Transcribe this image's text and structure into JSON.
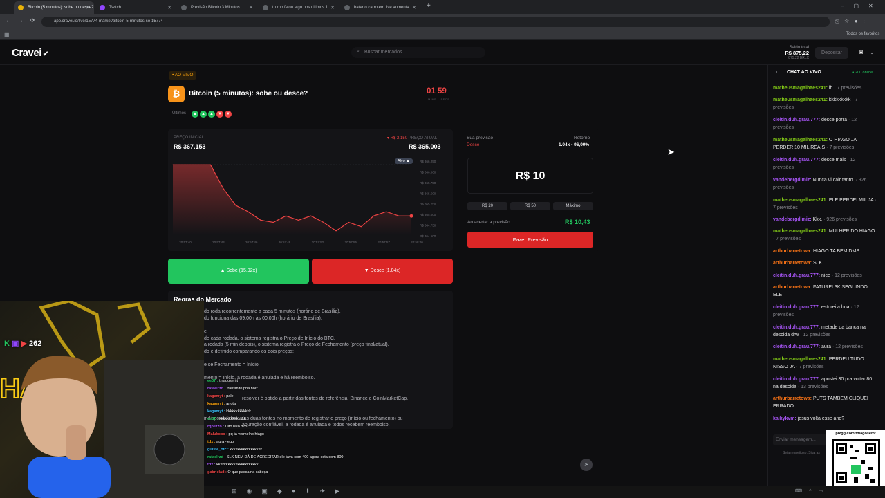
{
  "browser": {
    "tabs": [
      {
        "label": "Bitcoin (5 minutos): sobe ou desce?",
        "active": true,
        "color": "#eab308"
      },
      {
        "label": "Twitch",
        "active": false,
        "color": "#9146ff"
      },
      {
        "label": "Previsão Bitcoin 3 Minutos",
        "active": false,
        "color": "#9aa0a6"
      },
      {
        "label": "trump falou algo nos ultimos 1",
        "active": false,
        "color": "#9aa0a6"
      },
      {
        "label": "bater o carro em live aumenta",
        "active": false,
        "color": "#9aa0a6"
      }
    ],
    "new_tab": "+",
    "url": "app.cravei.io/live/15774-market/bitcoin-5-minutos-so-15774",
    "bookmarks_label": "Todos os favoritos"
  },
  "header": {
    "logo": "Cravei",
    "search_placeholder": "Buscar mercados...",
    "balance_label": "Saldo total",
    "balance_value": "R$ 875,22",
    "balance_sub": "875,22 BRLX",
    "deposit_label": "Depositar",
    "user_initial": "H"
  },
  "market": {
    "live_badge": "• AO VIVO",
    "title": "Bitcoin (5 minutos): sobe ou desce?",
    "timer_min": "01",
    "timer_sec": "59",
    "timer_min_label": "MINS",
    "timer_sec_label": "SECS",
    "ultimos_label": "Últimos",
    "history": [
      "up",
      "up",
      "up",
      "down",
      "down"
    ],
    "price_start_label": "PREÇO INICIAL",
    "price_start": "R$ 367.153",
    "price_delta": "▾ R$ 2.150",
    "price_now_label": "PREÇO ATUAL",
    "price_now": "R$ 365.003",
    "alvo_label": "Alvo ▲",
    "up_label": "Sobe (15.92x)",
    "down_label": "Desce (1.04x)",
    "rules_title": "Regras do Mercado"
  },
  "chart_data": {
    "type": "line",
    "x": [
      "20:57:40",
      "20:57:43",
      "20:57:46",
      "20:57:49",
      "20:57:52",
      "20:57:55",
      "20:57:57",
      "20:58:00"
    ],
    "values": [
      366.15,
      366.15,
      366.15,
      366.15,
      365.6,
      365.2,
      365.05,
      364.85,
      364.8,
      364.95,
      364.85,
      364.95,
      364.8,
      364.6,
      364.8,
      364.7,
      364.95,
      365.05,
      364.95,
      364.95
    ],
    "yticks": [
      "R$ 366.250",
      "R$ 366.000",
      "R$ 365.750",
      "R$ 365.500",
      "R$ 365.250",
      "R$ 365.000",
      "R$ 364.750",
      "R$ 364.500"
    ],
    "ylim": [
      364.5,
      366.25
    ],
    "line_color": "#ef4444"
  },
  "prediction": {
    "label": "Sua previsão",
    "side": "Desce",
    "return_label": "Retorno",
    "return_value": "1.04x • 96,00%",
    "amount": "R$ 10",
    "quick": [
      "R$ 20",
      "R$ 50",
      "Máximo"
    ],
    "hit_label": "Ao acertar a previsão",
    "hit_value": "R$ 10,43",
    "submit": "Fazer Previsão"
  },
  "rules": [
    "do roda recorrentemente a cada 5 minutos (horário de Brasília).",
    "do funciona das 09:00h às 00:00h (horário de Brasília).",
    "e",
    "de cada rodada, o sistema registra o Preço de Início do BTC.",
    "a rodada (5 min depois), o sistema registra o Preço de Fechamento (preço final/atual).",
    "do é definido comparando os dois preços:",
    "e se Fechamento = Início",
    "mento = Início, a rodada é anulada e há reembolso.",
    "resolver é obtido a partir das fontes de referência: Binance e CoinMarketCap.",
    "indisponibilidade das duas fontes no momento de registrar o preço (início ou fechamento) ou",
    "apuração confiável, a rodada é anulada e todos recebem reembolso."
  ],
  "chat": {
    "title": "CHAT AO VIVO",
    "online": "● 200 online",
    "messages": [
      {
        "user": "matheusmagalhaes241:",
        "text": " ih",
        "meta": " · 7 previsões",
        "c": "c1"
      },
      {
        "user": "matheusmagalhaes241:",
        "text": " kkkkkkkkk",
        "meta": " · 7 previsões",
        "c": "c1"
      },
      {
        "user": "cleitin.duh.grau.777:",
        "text": " desce porra",
        "meta": " · 12 previsões",
        "c": "c2"
      },
      {
        "user": "matheusmagalhaes241:",
        "text": " O HIAGO JA PERDER 10 MIL REAIS",
        "meta": " · 7 previsões",
        "c": "c1"
      },
      {
        "user": "cleitin.duh.grau.777:",
        "text": " desce mais",
        "meta": " · 12 previsões",
        "c": "c2"
      },
      {
        "user": "vandebergdimiz:",
        "text": " Nunca vi cair tanto.",
        "meta": " · 926 previsões",
        "c": "c2"
      },
      {
        "user": "matheusmagalhaes241:",
        "text": " ELE PERDEI MIL JA",
        "meta": " · 7 previsões",
        "c": "c1"
      },
      {
        "user": "vandebergdimiz:",
        "text": " Kkk.",
        "meta": " · 926 previsões",
        "c": "c2"
      },
      {
        "user": "matheusmagalhaes241:",
        "text": " MULHER DO HIAGO",
        "meta": " · 7 previsões",
        "c": "c1"
      },
      {
        "user": "arthurbarretowa:",
        "text": " HIAGO TA BEM DMS",
        "meta": "",
        "c": "c3"
      },
      {
        "user": "arthurbarretowa:",
        "text": " SLK",
        "meta": "",
        "c": "c3"
      },
      {
        "user": "cleitin.duh.grau.777:",
        "text": " nice",
        "meta": " · 12 previsões",
        "c": "c2"
      },
      {
        "user": "arthurbarretowa:",
        "text": " FATUREI 3K SEGUINDO ELE",
        "meta": "",
        "c": "c3"
      },
      {
        "user": "cleitin.duh.grau.777:",
        "text": " estorei a boa",
        "meta": " · 12 previsões",
        "c": "c2"
      },
      {
        "user": "cleitin.duh.grau.777:",
        "text": " metade da banca na descida drw",
        "meta": " · 12 previsões",
        "c": "c2"
      },
      {
        "user": "cleitin.duh.grau.777:",
        "text": " aura",
        "meta": " · 12 previsões",
        "c": "c2"
      },
      {
        "user": "matheusmagalhaes241:",
        "text": " PERDEU TUDO NISSO JA",
        "meta": " · 7 previsões",
        "c": "c1"
      },
      {
        "user": "cleitin.duh.grau.777:",
        "text": " apostei 30 pra voltar 80 na descida",
        "meta": " · 13 previsões",
        "c": "c2"
      },
      {
        "user": "arthurbarretowa:",
        "text": " PUTS TAMBEM CLIQUEI ERRADO",
        "meta": "",
        "c": "c3"
      },
      {
        "user": "kaikykvm:",
        "text": " jesus volta esse ano?",
        "meta": "",
        "c": "c2"
      }
    ],
    "input_placeholder": "Enviar mensagem...",
    "footer": "Seja respeitoso. Siga as",
    "qr_label": "pixgg.com/thiagosemt"
  },
  "stream": {
    "viewers": "262",
    "chat": [
      {
        "user": "ee07 :",
        "text": " thiagosemt"
      },
      {
        "user": "rafaelrzd :",
        "text": " transmite pha noiz"
      },
      {
        "user": "kagamyt :",
        "text": " pale"
      },
      {
        "user": "kagamyt :",
        "text": " anota"
      },
      {
        "user": "kagamyt :",
        "text": " kkkkkkkkkkkkk"
      },
      {
        "user": "ee07 :",
        "text": " kkkkkkkkkkkkkk"
      },
      {
        "user": "rqpezzb :",
        "text": " Dito isso 875"
      },
      {
        "user": "Malukooo :",
        "text": " pq ta vermelho hiago"
      },
      {
        "user": "tdx :",
        "text": " aura - ego"
      },
      {
        "user": "guiste_ofc :",
        "text": " kkkkkkkkkkkkkkkkk"
      },
      {
        "user": "rafaelrzd :",
        "text": " SLK NEM DÁ DE ACREDITAR ele tava com 400 agora esta com 800"
      },
      {
        "user": "tdx :",
        "text": " kkkkkkkkkkkkkkkkkkkkkk"
      },
      {
        "user": "gabrielad :",
        "text": " O que passa na cabeça"
      }
    ]
  }
}
